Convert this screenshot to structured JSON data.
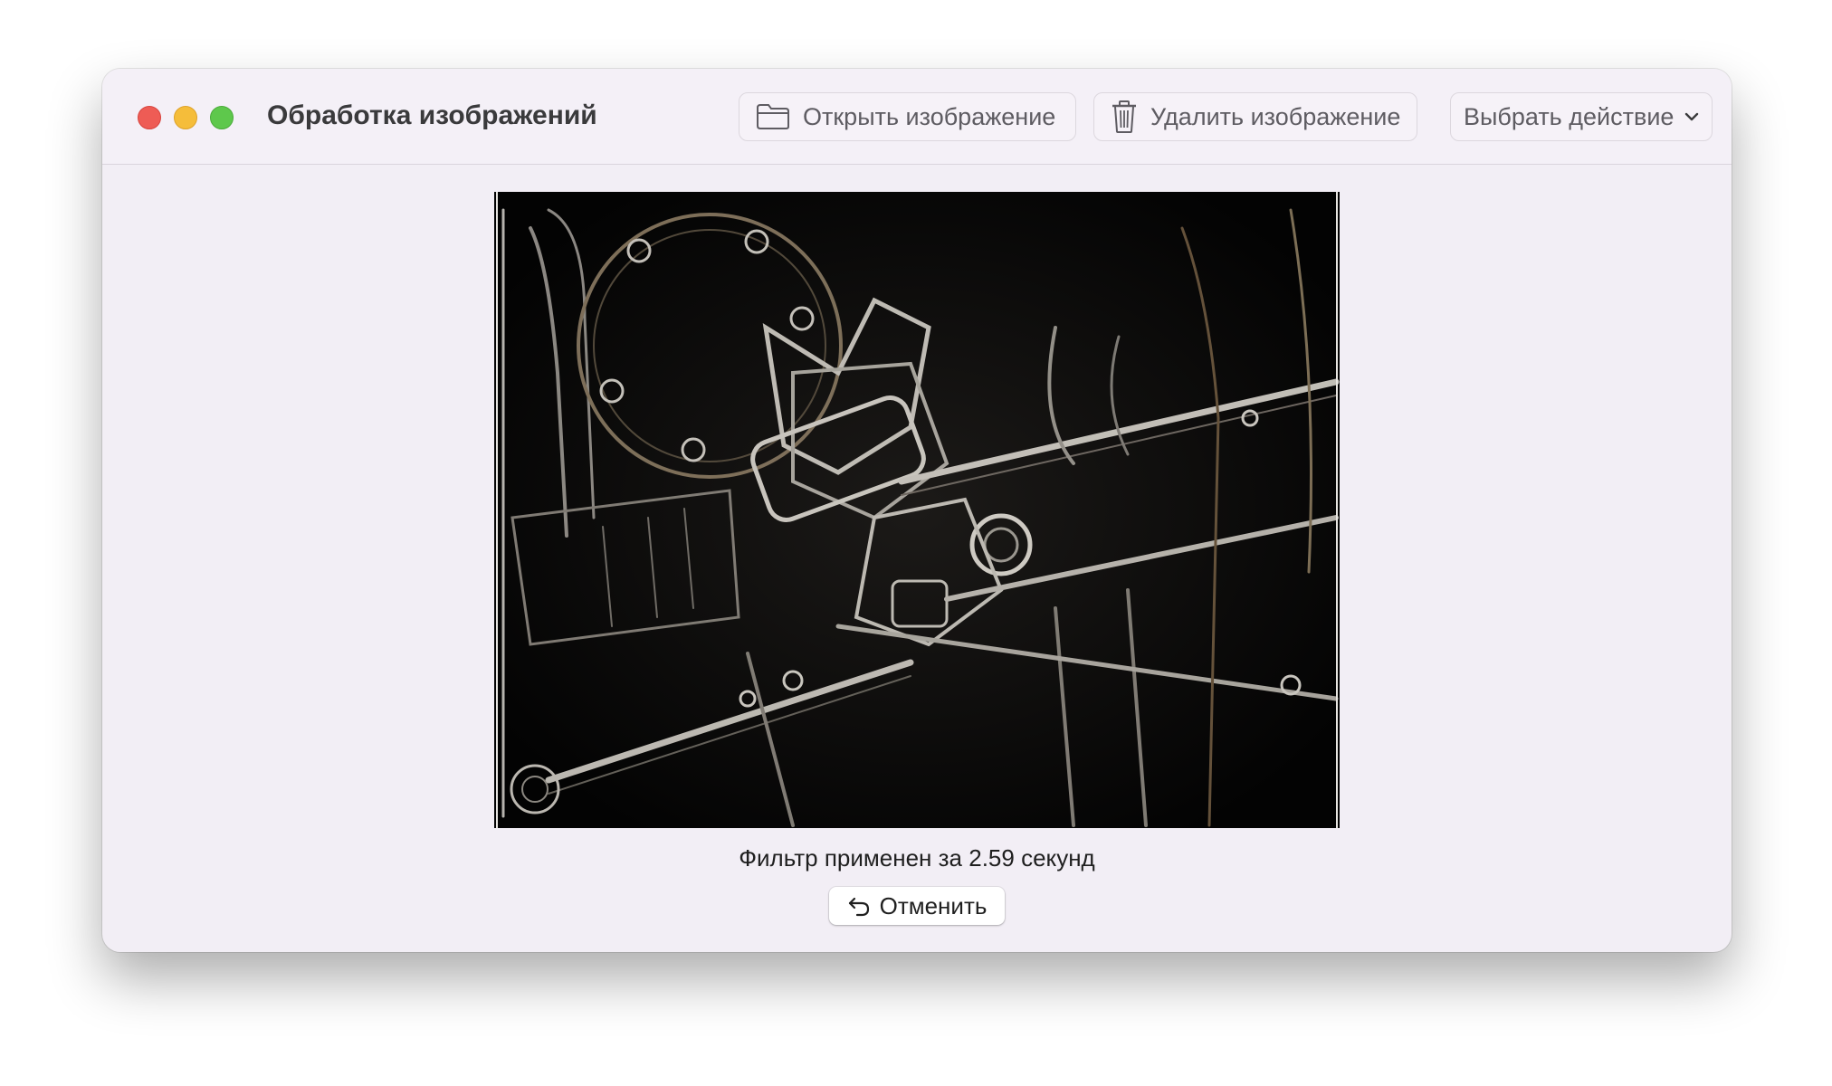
{
  "window": {
    "title": "Обработка изображений",
    "controls": [
      "close",
      "minimize",
      "zoom"
    ]
  },
  "toolbar": {
    "open_label": "Открыть изображение",
    "open_icon": "folder-icon",
    "delete_label": "Удалить изображение",
    "delete_icon": "trash-icon",
    "action_label": "Выбрать действие",
    "action_icon": "chevron-down-icon"
  },
  "content": {
    "image_description_icon": "processed-image",
    "status": "Фильтр применен за 2.59 секунд",
    "undo_label": "Отменить",
    "undo_icon": "undo-arrow-icon"
  },
  "colors": {
    "close": "#ee5c55",
    "minimize": "#f5bd3a",
    "zoom": "#5ec84c",
    "window_bg": "#f2eef5"
  }
}
